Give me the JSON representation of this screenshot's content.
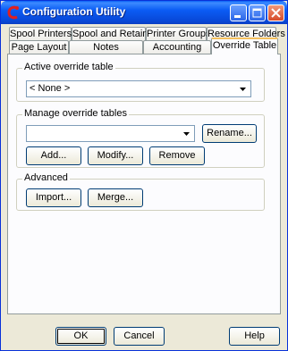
{
  "window": {
    "title": "Configuration Utility"
  },
  "icons": {
    "app": "app-logo-icon",
    "minimize": "minimize-icon",
    "maximize": "maximize-icon",
    "close": "close-icon",
    "dropdown": "chevron-down-icon"
  },
  "tabs_back": [
    "Spool Printers",
    "Spool and Retain",
    "Printer Groups",
    "Resource Folders"
  ],
  "tabs_front": [
    "Page Layout",
    "Notes",
    "Accounting",
    "Override Table"
  ],
  "active_tab": "Override Table",
  "active_override": {
    "label": "Active override table",
    "value": "< None >"
  },
  "manage": {
    "label": "Manage override tables",
    "value": "",
    "rename": "Rename...",
    "add": "Add...",
    "modify": "Modify...",
    "remove": "Remove"
  },
  "advanced": {
    "label": "Advanced",
    "import": "Import...",
    "merge": "Merge..."
  },
  "footer": {
    "ok": "OK",
    "cancel": "Cancel",
    "help": "Help"
  }
}
